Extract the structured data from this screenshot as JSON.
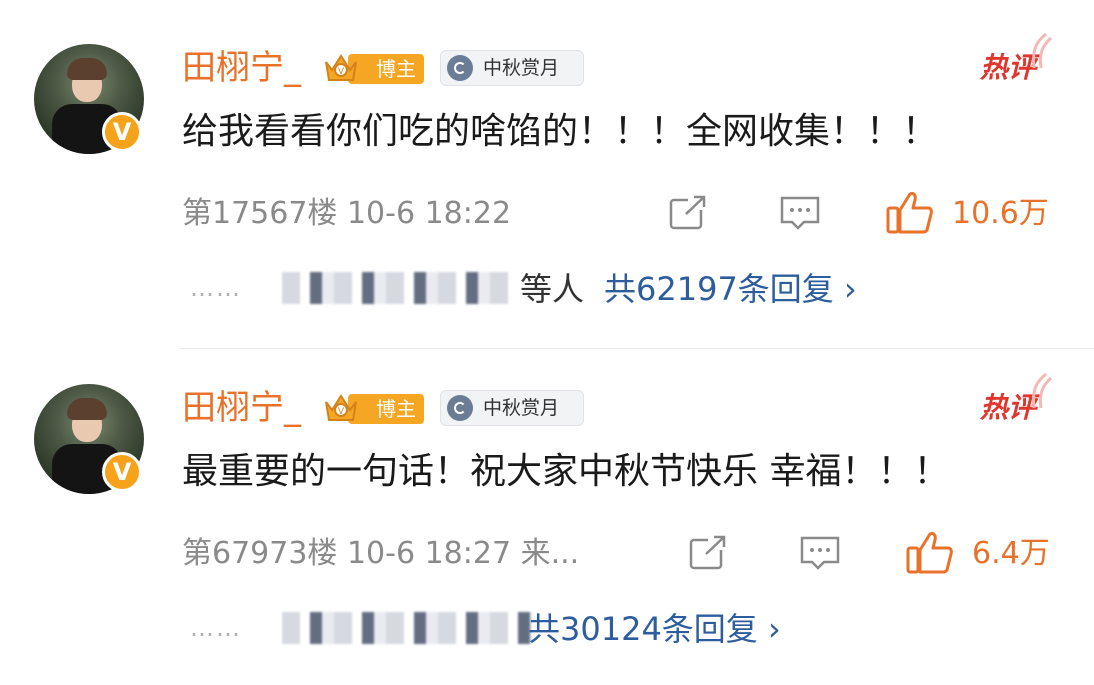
{
  "comments": [
    {
      "username": "田栩宁_",
      "blogger_tag": "博主",
      "event_tag": "中秋赏月",
      "hot_label": "热评",
      "content": "给我看看你们吃的啥馅的！！！全网收集！！！",
      "floor_time": "第17567楼 10-6 18:22",
      "likes": "10.6万",
      "reply_prefix": "等人",
      "reply_summary": "共62197条回复 ›"
    },
    {
      "username": "田栩宁_",
      "blogger_tag": "博主",
      "event_tag": "中秋赏月",
      "hot_label": "热评",
      "content": "最重要的一句话！祝大家中秋节快乐 幸福！！！",
      "floor_time": "第67973楼 10-6 18:27 来...",
      "likes": "6.4万",
      "reply_prefix": "",
      "reply_summary": "共30124条回复 ›"
    }
  ],
  "ui": {
    "dots": "……",
    "accent_color": "#e8722a",
    "link_color": "#2d5d9c",
    "hot_color": "#e0362d",
    "icons": [
      "share-icon",
      "comment-icon",
      "like-icon"
    ]
  }
}
